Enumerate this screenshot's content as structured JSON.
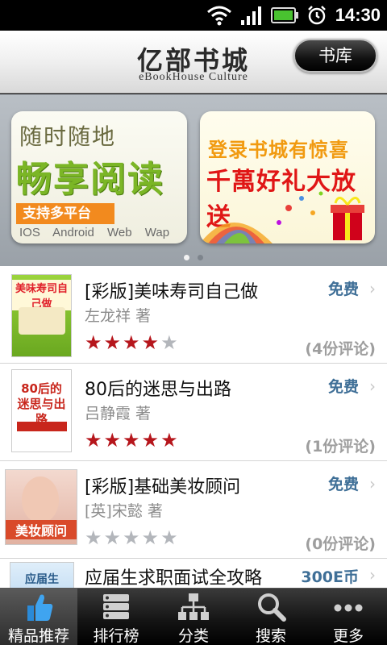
{
  "status_bar": {
    "time": "14:30",
    "icons": [
      "wifi-icon",
      "signal-icon",
      "battery-icon",
      "alarm-icon"
    ]
  },
  "header": {
    "title": "亿部书城",
    "subtitle": "eBookHouse Culture",
    "library_button": "书库"
  },
  "banner": {
    "card1": {
      "line1": "随时随地",
      "line2": "畅享阅读",
      "tag": "支持多平台",
      "platforms": "IOS Android Web Wap"
    },
    "card2": {
      "line1": "登录书城有惊喜",
      "line2": "千萬好礼大放送"
    },
    "page_count": 2,
    "active_page": 1
  },
  "books": [
    {
      "title": "[彩版]美味寿司自己做",
      "author": "左龙祥 著",
      "price": "免费",
      "rating": 4,
      "reviews": "(4份评论)",
      "cover_text": "美味寿司自己做",
      "cover_color": "#7fbf2a"
    },
    {
      "title": "80后的迷思与出路",
      "author": "吕静霞 著",
      "price": "免费",
      "rating": 5,
      "reviews": "(1份评论)",
      "cover_text": "80后的迷思与出路",
      "cover_color": "#c8261c"
    },
    {
      "title": "[彩版]基础美妆顾问",
      "author": "[英]宋懿 著",
      "price": "免费",
      "rating": 0,
      "reviews": "(0份评论)",
      "cover_text": "美妆顾问",
      "cover_color": "#d94a2a"
    },
    {
      "title": "应届生求职面试全攻略",
      "price": "300E币",
      "cover_text": "应届生",
      "cover_color": "#3a7fc0"
    }
  ],
  "tabs": [
    {
      "label": "精品推荐",
      "icon": "thumbs-up-icon",
      "active": true
    },
    {
      "label": "排行榜",
      "icon": "ranking-icon",
      "active": false
    },
    {
      "label": "分类",
      "icon": "category-icon",
      "active": false
    },
    {
      "label": "搜索",
      "icon": "search-icon",
      "active": false
    },
    {
      "label": "更多",
      "icon": "more-icon",
      "active": false
    }
  ],
  "colors": {
    "accent_red": "#b6161c",
    "price_blue": "#3f6f97",
    "banner_green": "#7bb626",
    "banner_orange": "#f28a1e"
  }
}
